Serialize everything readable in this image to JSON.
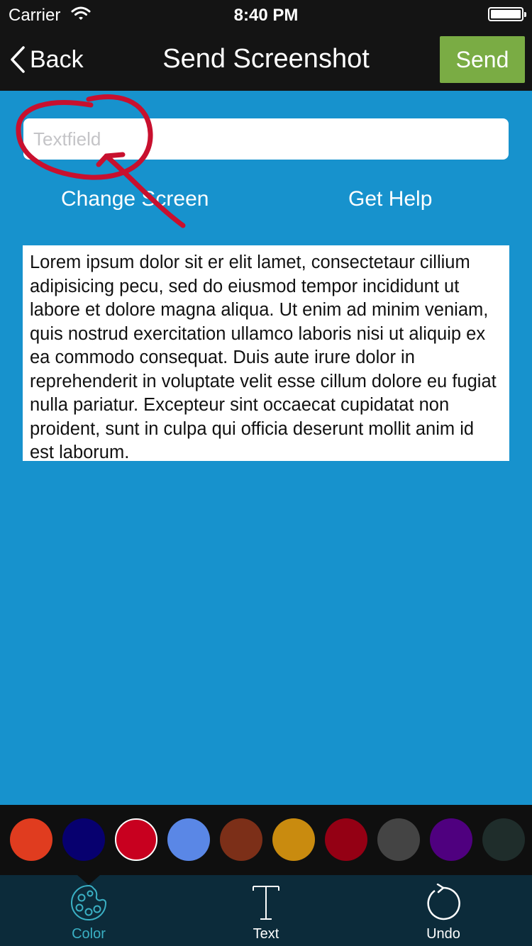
{
  "status": {
    "carrier": "Carrier",
    "time": "8:40 PM"
  },
  "nav": {
    "back_label": "Back",
    "title": "Send Screenshot",
    "send_label": "Send"
  },
  "form": {
    "textfield_placeholder": "Textfield",
    "change_screen": "Change Screen",
    "get_help": "Get Help"
  },
  "body_text": "Lorem ipsum dolor sit er elit lamet, consectetaur cillium adipisicing pecu, sed do eiusmod tempor incididunt ut labore et dolore magna aliqua. Ut enim ad minim veniam, quis nostrud exercitation ullamco laboris nisi ut aliquip ex ea commodo consequat. Duis aute irure dolor in reprehenderit in voluptate velit esse cillum dolore eu fugiat nulla pariatur. Excepteur sint occaecat cupidatat non proident, sunt in culpa qui officia deserunt mollit anim id est laborum.",
  "annotation_color": "#c8102e",
  "palette": {
    "colors": [
      "#e03c1f",
      "#07006f",
      "#c8001f",
      "#5a87e6",
      "#7c2f18",
      "#c98b0f",
      "#940014",
      "#444444",
      "#4f007f",
      "#1f2d2b"
    ],
    "selected_index": 2
  },
  "tabs": [
    {
      "label": "Color",
      "icon": "palette-icon",
      "active": true
    },
    {
      "label": "Text",
      "icon": "text-icon",
      "active": false
    },
    {
      "label": "Undo",
      "icon": "undo-icon",
      "active": false
    }
  ]
}
